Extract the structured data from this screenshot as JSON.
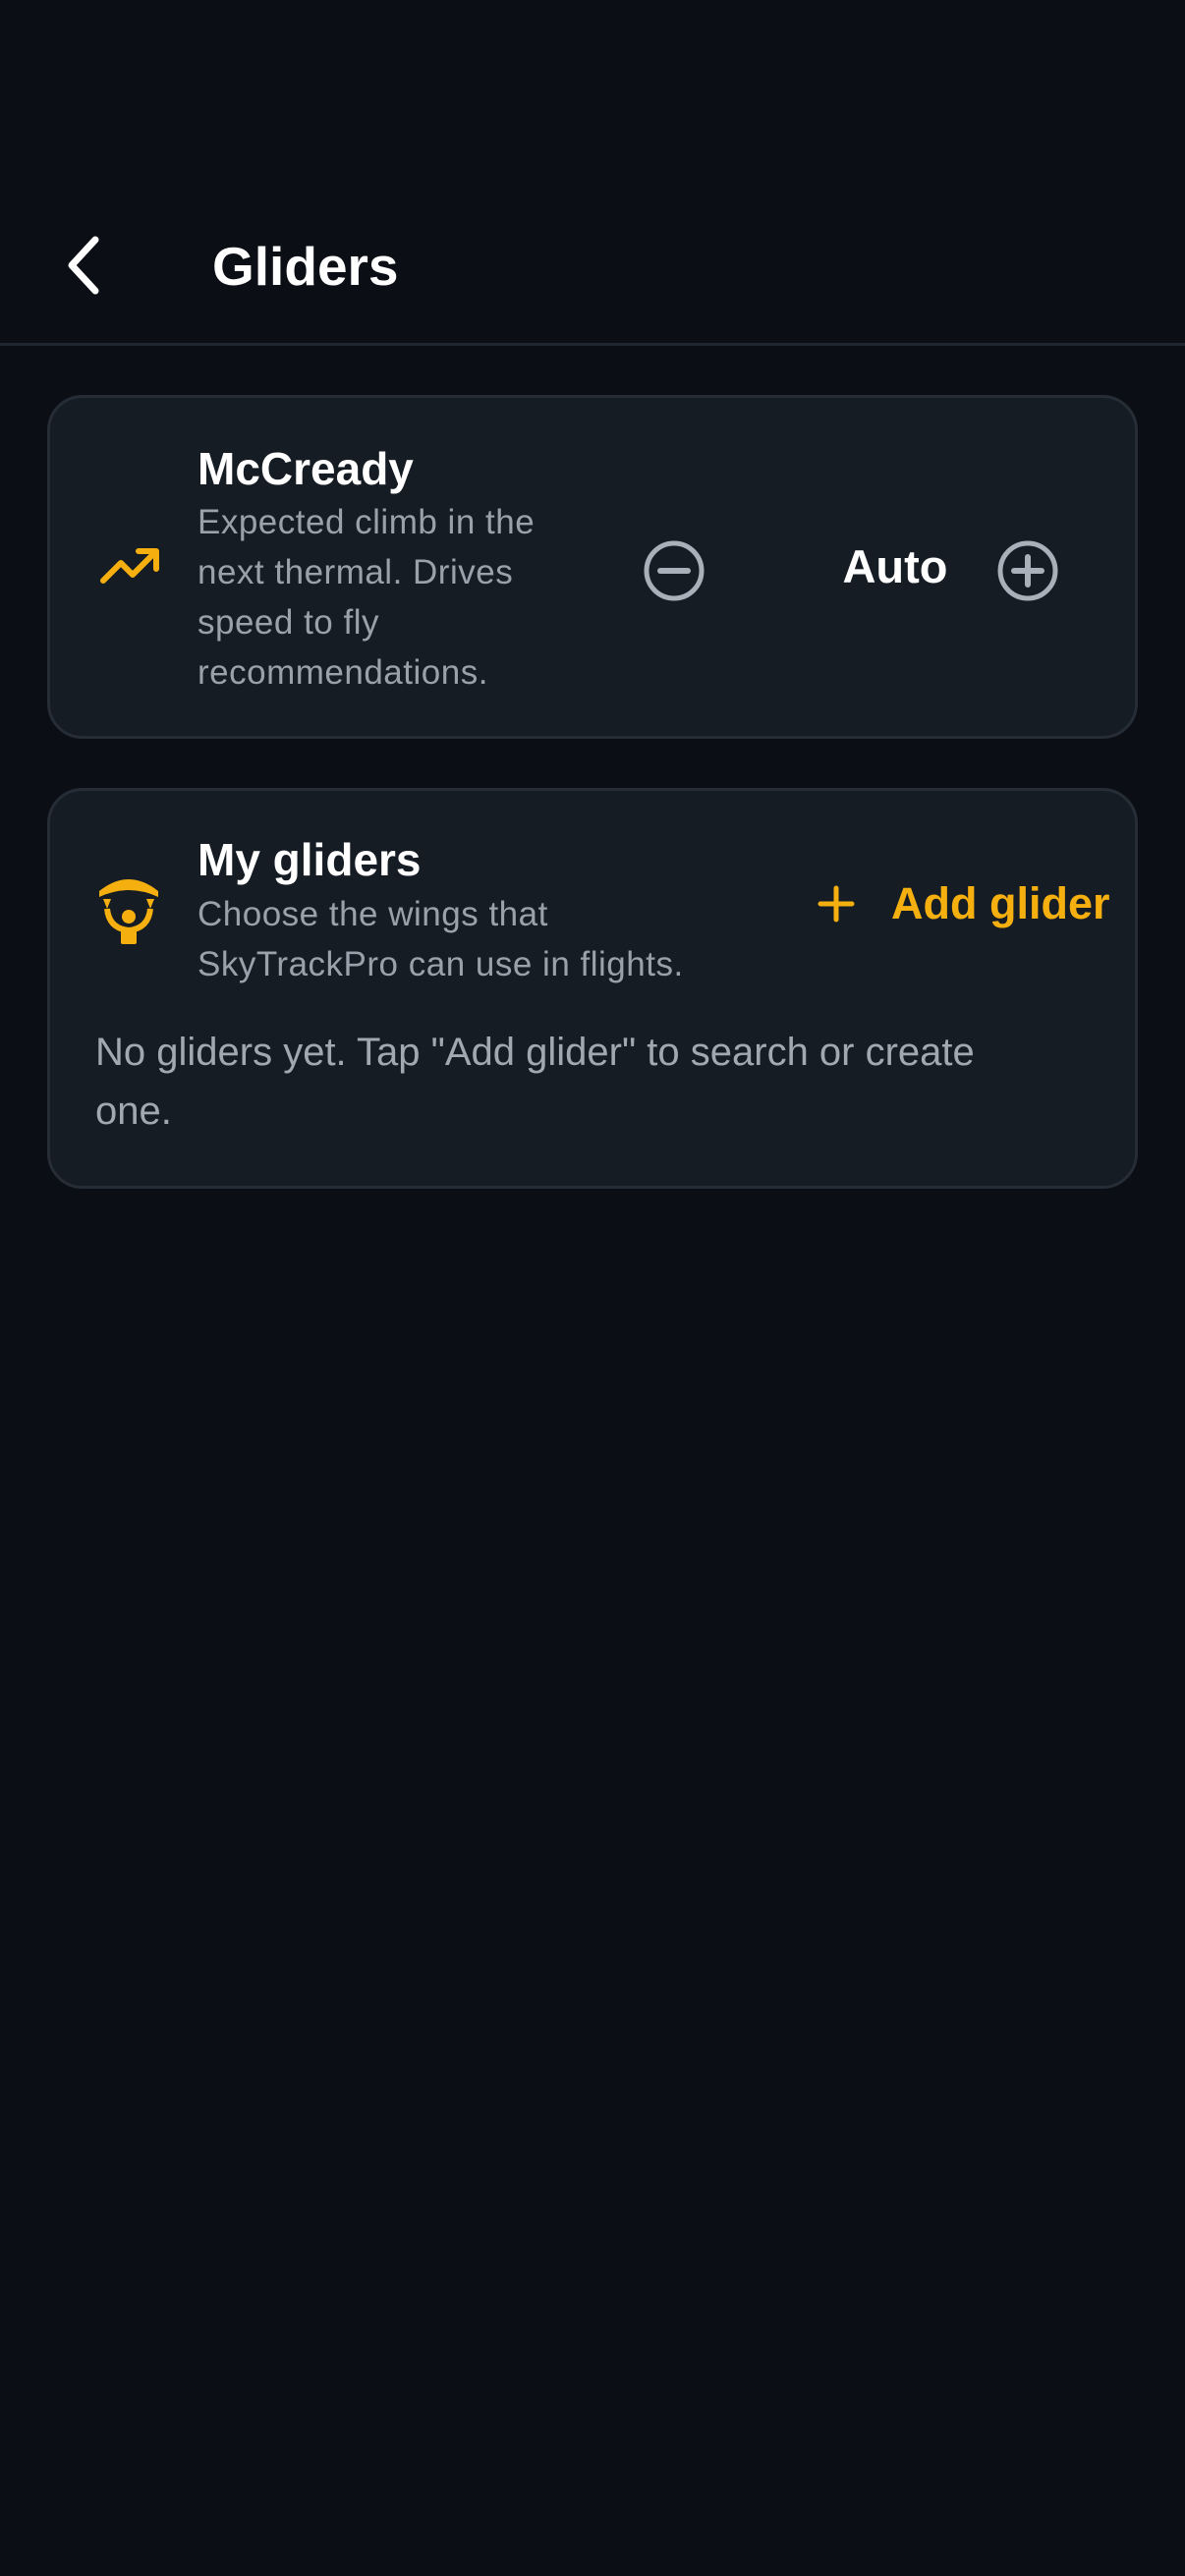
{
  "header": {
    "title": "Gliders"
  },
  "mccready": {
    "title": "McCready",
    "description_lines": [
      "Expected climb in the",
      "next thermal. Drives",
      "speed to fly",
      "recommendations."
    ],
    "value": "Auto",
    "icon": "trending-up-icon"
  },
  "gliders": {
    "title": "My gliders",
    "description_lines": [
      "Choose the wings that",
      "SkyTrackPro can use in flights."
    ],
    "add_label": "Add glider",
    "empty_lines": [
      "No gliders yet. Tap \"Add glider\" to search or create",
      "one."
    ],
    "icon": "paraglider-icon"
  },
  "colors": {
    "background": "#0b0e15",
    "card": "#161c24",
    "card_border": "#262d37",
    "accent": "#f5b00f",
    "muted_text": "#9aa1ab",
    "icon_gray": "#a9b0ba"
  }
}
